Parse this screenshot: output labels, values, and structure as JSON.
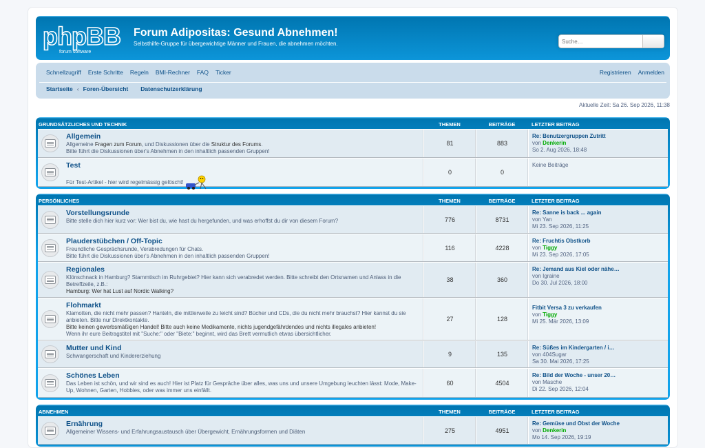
{
  "header": {
    "logo_text": "phpBB",
    "logo_sub": "forum software",
    "title": "Forum Adipositas: Gesund Abnehmen!",
    "description": "Selbsthilfe-Gruppe für übergewichtige Männer und Frauen, die abnehmen möchten.",
    "search_placeholder": "Suche…"
  },
  "nav": {
    "links": [
      "Schnellzugriff",
      "Erste Schritte",
      "Regeln",
      "BMI-Rechner",
      "FAQ",
      "Ticker"
    ],
    "right": [
      "Registrieren",
      "Anmelden"
    ],
    "crumbs": [
      "Startseite",
      "Foren-Übersicht",
      "Datenschutzerklärung"
    ]
  },
  "current_time": "Aktuelle Zeit: Sa 26. Sep 2026, 11:38",
  "columns": {
    "topics": "Themen",
    "posts": "Beiträge",
    "last": "Letzter Beitrag"
  },
  "categories": [
    {
      "name": "Grundsätzliches und Technik",
      "forums": [
        {
          "title": "Allgemein",
          "desc1": "Allgemeine ",
          "desc1b": "Fragen zum Forum",
          "desc1c": ", und Diskussionen über die ",
          "desc1d": "Struktur des Forums",
          "desc1e": ".",
          "desc2": "Bitte führt die Diskussionen über's Abnehmen in den inhaltlich passenden Gruppen!",
          "topics": "81",
          "posts": "883",
          "last_title": "Re: Benutzergruppen Zutritt",
          "last_by_prefix": "von ",
          "last_by": "Denkerin",
          "last_date": "So 2. Aug 2026, 18:48"
        },
        {
          "title": "Test",
          "desc1": "Für Test-Artikel - hier wird regelmässig gelöscht!",
          "topics": "0",
          "posts": "0",
          "no_posts": "Keine Beiträge"
        }
      ]
    },
    {
      "name": "Persönliches",
      "forums": [
        {
          "title": "Vorstellungsrunde",
          "desc1": "Bitte stelle dich hier kurz vor: Wer bist du, wie hast du hergefunden, und was erhoffst du dir von diesem Forum?",
          "topics": "776",
          "posts": "8731",
          "last_title": "Re: Sanne is back ... again",
          "last_by_prefix": "von ",
          "last_by": "Yan",
          "last_date": "Mi 23. Sep 2026, 11:25"
        },
        {
          "title": "Plauderstübchen / Off-Topic",
          "desc1": "Freundliche Gesprächsrunde, Verabredungen für Chats.",
          "desc2": "Bitte führt die Diskussionen über's Abnehmen in den inhaltlich passenden Gruppen!",
          "topics": "116",
          "posts": "4228",
          "last_title": "Re: Fruchtis Obstkorb",
          "last_by_prefix": "von ",
          "last_by": "Tiggy",
          "last_date": "Mi 23. Sep 2026, 17:05"
        },
        {
          "title": "Regionales",
          "desc1": "Klönschnack in Hamburg? Stammtisch im Ruhrgebiet? Hier kann sich verabredet werden. Bitte schreibt den Ortsnamen und Anlass in die Betreffzeile, z.B.:",
          "desc2": "Hamburg: Wer hat Lust auf Nordic Walking?",
          "topics": "38",
          "posts": "360",
          "last_title": "Re: Jemand aus Kiel oder nähe…",
          "last_by_prefix": "von ",
          "last_by": "Igraine",
          "last_date": "Do 30. Jul 2026, 18:00"
        },
        {
          "title": "Flohmarkt",
          "desc1": "Klamotten, die nicht mehr passen? Hanteln, die mittlerweile zu leicht sind? Bücher und CDs, die du nicht mehr brauchst? Hier kannst du sie anbieten. Bitte nur Direktkontakte.",
          "desc2": "Bitte keinen gewerbsmäßigen Handel! Bitte auch keine Medikamente, nichts jugendgefährdendes und nichts illegales anbieten!",
          "desc3": "Wenn ihr eure Beitragstitel mit \"Suche:\" oder \"Biete:\" beginnt, wird das Brett vermutlich etwas übersichtlicher.",
          "topics": "27",
          "posts": "128",
          "last_title": "Fitbit Versa 3 zu verkaufen",
          "last_by_prefix": "von ",
          "last_by": "Tiggy",
          "last_date": "Mi 25. Mär 2026, 13:09"
        },
        {
          "title": "Mutter und Kind",
          "desc1": "Schwangerschaft und Kindererziehung",
          "topics": "9",
          "posts": "135",
          "last_title": "Re: Süßes im Kindergarten / i…",
          "last_by_prefix": "von ",
          "last_by": "404Sugar",
          "last_date": "Sa 30. Mai 2026, 17:25"
        },
        {
          "title": "Schönes Leben",
          "desc1": "Das Leben ist schön, und wir sind es auch! Hier ist Platz für Gespräche über alles, was uns und unsere Umgebung leuchten lässt: Mode, Make-Up, Wohnen, Garten, Hobbies, oder was immer uns einfällt.",
          "topics": "60",
          "posts": "4504",
          "last_title": "Re: Bild der Woche - unser 20…",
          "last_by_prefix": "von ",
          "last_by": "Masche",
          "last_date": "Di 22. Sep 2026, 12:04"
        }
      ]
    },
    {
      "name": "Abnehmen",
      "forums": [
        {
          "title": "Ernährung",
          "desc1": "Allgemeiner Wissens- und Erfahrungsaustausch über Übergewicht, Ernährungsformen und Diäten",
          "topics": "275",
          "posts": "4951",
          "last_title": "Re: Gemüse und Obst der Woche",
          "last_by_prefix": "von ",
          "last_by": "Denkerin",
          "last_date": "Mo 14. Sep 2026, 19:19"
        }
      ]
    }
  ]
}
